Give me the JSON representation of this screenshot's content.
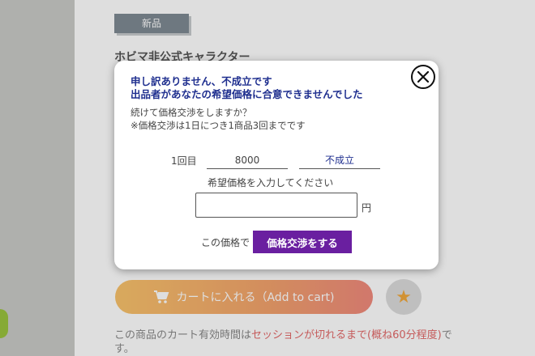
{
  "page": {
    "badge": "新品",
    "product_title": "ホビマ非公式キャラクター",
    "cart_button_label": "カートに入れる（Add to cart)",
    "favorite_icon": "star-icon",
    "cart_note_prefix": "この商品のカート有効時間は",
    "cart_note_highlight": "セッションが切れるまで(概ね60分程度)",
    "cart_note_suffix": "です。"
  },
  "modal": {
    "title_line1": "申し訳ありません、不成立です",
    "title_line2": "出品者があなたの希望価格に合意できませんでした",
    "body_line1": "続けて価格交渉をしますか？",
    "body_line2": "※価格交渉は1日につき1商品3回までです",
    "round_label": "1回目",
    "round_price": "8000",
    "round_result": "不成立",
    "input_label": "希望価格を入力してください",
    "input_value": "",
    "input_placeholder": "",
    "currency_unit": "円",
    "submit_prefix": "この価格で",
    "submit_label": "価格交渉をする"
  },
  "colors": {
    "accent_purple": "#6a1fa0",
    "title_blue": "#1f2f8f",
    "cart_gradient_start": "#f9c36b",
    "cart_gradient_end": "#f08a7c"
  }
}
